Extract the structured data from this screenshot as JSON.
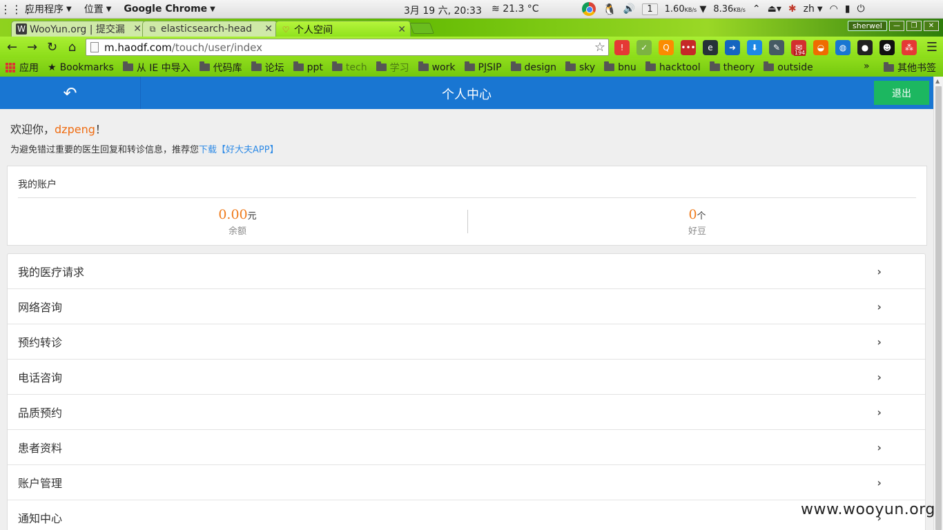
{
  "system_panel": {
    "apps_menu": "应用程序",
    "places_menu": "位置",
    "active_app": "Google Chrome",
    "clock": "3月 19 六, 20:33",
    "weather": "21.3 °C",
    "workspace": "1",
    "net_down": "1.60",
    "net_up": "8.36",
    "rate_unit": "KB/s",
    "lang": "zh"
  },
  "tabs": [
    {
      "title": "WooYun.org | 提交漏",
      "icon": "wooyun-icon"
    },
    {
      "title": "elasticsearch-head",
      "icon": "puzzle-icon"
    },
    {
      "title": "个人空间",
      "icon": "haodf-icon"
    }
  ],
  "profile_name": "sherwel",
  "address": {
    "host": "m.haodf.com",
    "path": "/touch/user/index"
  },
  "bookmarks": [
    {
      "label": "应用",
      "type": "apps"
    },
    {
      "label": "Bookmarks",
      "type": "star"
    },
    {
      "label": "从 IE 中导入",
      "type": "folder"
    },
    {
      "label": "代码库",
      "type": "folder"
    },
    {
      "label": "论坛",
      "type": "folder"
    },
    {
      "label": "ppt",
      "type": "folder"
    },
    {
      "label": "tech",
      "type": "folder-dim"
    },
    {
      "label": "学习",
      "type": "folder-dim"
    },
    {
      "label": "work",
      "type": "folder"
    },
    {
      "label": "PJSIP",
      "type": "folder"
    },
    {
      "label": "design",
      "type": "folder"
    },
    {
      "label": "sky",
      "type": "folder"
    },
    {
      "label": "bnu",
      "type": "folder"
    },
    {
      "label": "hacktool",
      "type": "folder"
    },
    {
      "label": "theory",
      "type": "folder"
    },
    {
      "label": "outside",
      "type": "folder"
    }
  ],
  "bookmarks_more": "»",
  "other_bookmarks": "其他书签",
  "extensions": [
    {
      "name": "alert-icon",
      "color": "#e53935",
      "glyph": "!"
    },
    {
      "name": "check-icon",
      "color": "#7cb342",
      "glyph": "✓"
    },
    {
      "name": "q-icon",
      "color": "#fb8c00",
      "glyph": "Q"
    },
    {
      "name": "dots-icon",
      "color": "#c62828",
      "glyph": "•••"
    },
    {
      "name": "e-icon",
      "color": "#263238",
      "glyph": "e"
    },
    {
      "name": "arrow-icon",
      "color": "#1565c0",
      "glyph": "➜"
    },
    {
      "name": "download-icon",
      "color": "#1e88e5",
      "glyph": "⬇"
    },
    {
      "name": "evernote-icon",
      "color": "#455a64",
      "glyph": "✎"
    },
    {
      "name": "gmail-icon",
      "color": "#d32f2f",
      "glyph": "✉"
    },
    {
      "name": "basket-icon",
      "color": "#ef6c00",
      "glyph": "◒"
    },
    {
      "name": "globe-icon",
      "color": "#1976d2",
      "glyph": "◍"
    },
    {
      "name": "keyhole-icon",
      "color": "#212121",
      "glyph": "●"
    },
    {
      "name": "mask-icon",
      "color": "#111111",
      "glyph": "☻"
    },
    {
      "name": "dots-red-icon",
      "color": "#e53935",
      "glyph": "⁂"
    }
  ],
  "gmail_badge": "194",
  "header": {
    "title": "个人中心",
    "logout": "退出"
  },
  "welcome": {
    "prefix": "欢迎你，",
    "username": "dzpeng",
    "suffix": "！"
  },
  "notice": {
    "text": "为避免错过重要的医生回复和转诊信息，推荐您",
    "link": "下载【好大夫APP】"
  },
  "account": {
    "title": "我的账户",
    "balance": {
      "value": "0.00",
      "unit": "元",
      "label": "余额"
    },
    "beans": {
      "value": "0",
      "unit": "个",
      "label": "好豆"
    }
  },
  "menu": [
    "我的医疗请求",
    "网络咨询",
    "预约转诊",
    "电话咨询",
    "品质预约",
    "患者资料",
    "账户管理",
    "通知中心"
  ],
  "watermark": "www.wooyun.org"
}
